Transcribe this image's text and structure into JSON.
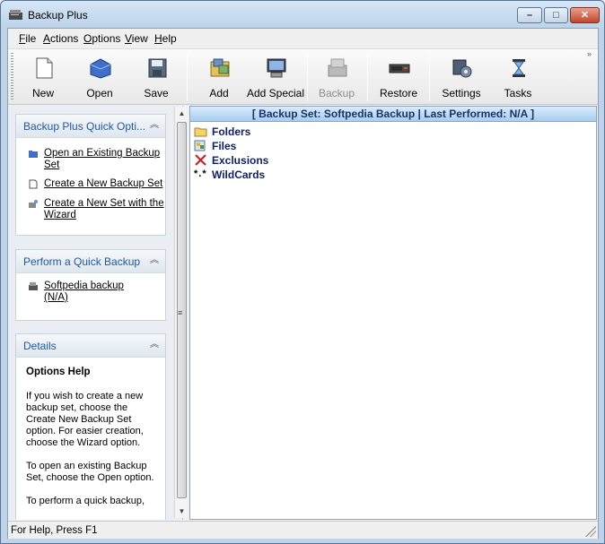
{
  "window": {
    "title": "Backup Plus"
  },
  "menu": [
    "File",
    "Actions",
    "Options",
    "View",
    "Help"
  ],
  "toolbar": {
    "new": "New",
    "open": "Open",
    "save": "Save",
    "add": "Add",
    "add_special": "Add Special",
    "backup": "Backup",
    "restore": "Restore",
    "settings": "Settings",
    "tasks": "Tasks"
  },
  "quick_options": {
    "title": "Backup Plus Quick Opti...",
    "items": [
      {
        "label": "Open an Existing Backup Set",
        "icon": "folder-icon"
      },
      {
        "label": "Create a New Backup Set",
        "icon": "new-document-icon"
      },
      {
        "label": "Create a New Set with the Wizard",
        "icon": "wizard-icon"
      }
    ]
  },
  "quick_backup": {
    "title": "Perform a Quick Backup",
    "items": [
      {
        "label": "Softpedia backup (N/A)",
        "icon": "backup-drive-icon"
      }
    ]
  },
  "details": {
    "title": "Details",
    "heading": "Options Help",
    "paragraphs": [
      "If you wish to create a new backup set, choose the Create New Backup Set option.  For easier creation, choose the Wizard option.",
      "To open an existing Backup Set, choose the Open option.",
      "To perform a quick backup,"
    ]
  },
  "tree": {
    "header": "[ Backup Set:  Softpedia Backup | Last Performed:  N/A ]",
    "items": [
      {
        "label": "Folders",
        "icon": "folder-icon"
      },
      {
        "label": "Files",
        "icon": "files-icon"
      },
      {
        "label": "Exclusions",
        "icon": "red-x-icon"
      },
      {
        "label": "WildCards",
        "icon": "wildcard-icon",
        "glyph": "*.*"
      }
    ]
  },
  "status": {
    "text": "For Help, Press F1"
  },
  "colors": {
    "link_blue": "#1f57a3",
    "tree_text": "#0d1f6b",
    "header_blue": "#a7cdef"
  }
}
